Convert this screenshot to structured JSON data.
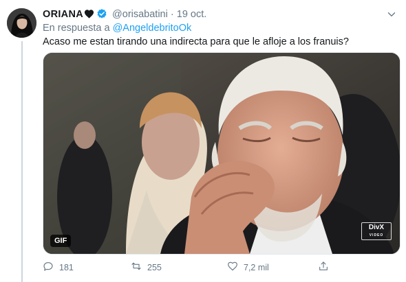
{
  "tweet": {
    "author_name": "ORIANA",
    "handle": "@orisabatini",
    "separator": "·",
    "date": "19 oct.",
    "reply_prefix": "En respuesta a",
    "reply_handle": "@AngeldebritoOk",
    "text": "Acaso me estan tirando una indirecta para que le afloje a los franuis?",
    "media_badge": "GIF",
    "watermark_main": "DivX",
    "watermark_sub": "VIDEO"
  },
  "icons": {
    "verified": "verified-badge-icon",
    "heart": "black-heart-icon",
    "menu": "chevron-down-icon",
    "reply": "reply-icon",
    "retweet": "retweet-icon",
    "like": "heart-outline-icon",
    "share": "share-icon"
  },
  "actions": {
    "reply_count": "181",
    "retweet_count": "255",
    "like_count": "7,2 mil"
  },
  "colors": {
    "accent": "#1da1f2",
    "muted_text": "#657786",
    "main_text": "#14171a",
    "thread_line": "#ccd6dd"
  }
}
